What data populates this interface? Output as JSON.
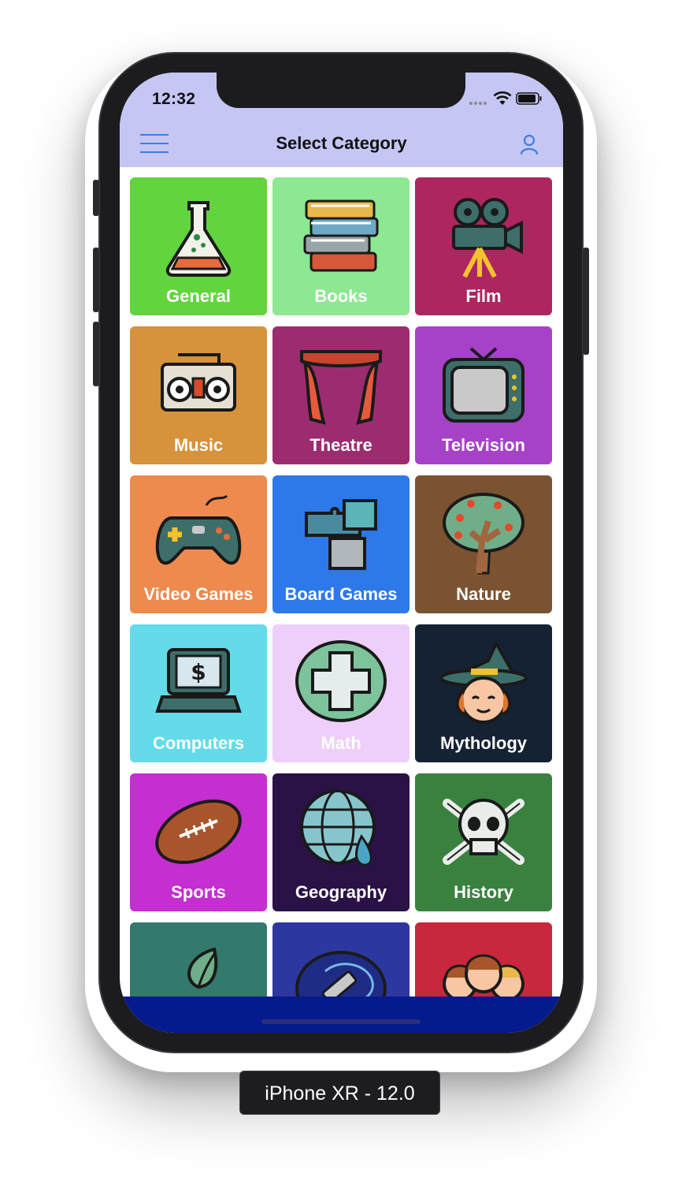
{
  "status_bar": {
    "time": "12:32"
  },
  "navigation": {
    "title": "Select Category"
  },
  "categories": [
    {
      "label": "General",
      "color": "#62d43e",
      "icon": "beaker-icon"
    },
    {
      "label": "Books",
      "color": "#8ce891",
      "icon": "books-icon"
    },
    {
      "label": "Film",
      "color": "#ad2660",
      "icon": "film-camera-icon"
    },
    {
      "label": "Music",
      "color": "#d7923c",
      "icon": "boombox-icon"
    },
    {
      "label": "Theatre",
      "color": "#9c2c6f",
      "icon": "theatre-curtain-icon"
    },
    {
      "label": "Television",
      "color": "#a642c7",
      "icon": "television-icon"
    },
    {
      "label": "Video Games",
      "color": "#ee8a4e",
      "icon": "gamepad-icon"
    },
    {
      "label": "Board Games",
      "color": "#2d79ea",
      "icon": "puzzle-icon"
    },
    {
      "label": "Nature",
      "color": "#7b5331",
      "icon": "tree-icon"
    },
    {
      "label": "Computers",
      "color": "#63dbe9",
      "icon": "laptop-icon"
    },
    {
      "label": "Math",
      "color": "#eecffa",
      "icon": "plus-icon"
    },
    {
      "label": "Mythology",
      "color": "#152233",
      "icon": "witch-icon"
    },
    {
      "label": "Sports",
      "color": "#c52ed0",
      "icon": "football-icon"
    },
    {
      "label": "Geography",
      "color": "#2a1246",
      "icon": "globe-icon"
    },
    {
      "label": "History",
      "color": "#3a813f",
      "icon": "skull-icon"
    },
    {
      "label": "",
      "color": "#33796c",
      "icon": "leaf-hand-icon"
    },
    {
      "label": "",
      "color": "#2c38a0",
      "icon": "pencil-icon"
    },
    {
      "label": "",
      "color": "#c8273c",
      "icon": "people-icon"
    }
  ],
  "device_label": "iPhone XR - 12.0"
}
